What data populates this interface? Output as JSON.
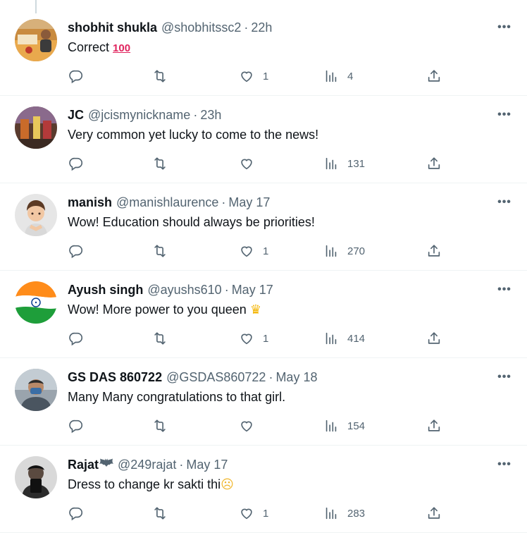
{
  "replies": [
    {
      "name": "shobhit shukla",
      "handle": "@shobhitssc2",
      "time": "22h",
      "text": "Correct",
      "emoji": "100",
      "likes": "1",
      "views": "4"
    },
    {
      "name": "JC",
      "handle": "@jcismynickname",
      "time": "23h",
      "text": "Very common yet lucky to come to the news!",
      "emoji": "",
      "likes": "",
      "views": "131"
    },
    {
      "name": "manish",
      "handle": "@manishlaurence",
      "time": "May 17",
      "text": "Wow! Education should always be priorities!",
      "emoji": "",
      "likes": "1",
      "views": "270"
    },
    {
      "name": "Ayush singh",
      "handle": "@ayushs610",
      "time": "May 17",
      "text": "Wow! More power to you queen",
      "emoji": "crown",
      "likes": "1",
      "views": "414"
    },
    {
      "name": "GS DAS 860722",
      "handle": "@GSDAS860722",
      "time": "May 18",
      "text": "Many Many congratulations to that girl.",
      "emoji": "",
      "likes": "",
      "views": "154"
    },
    {
      "name": "Rajat",
      "handle": "@249rajat",
      "time": "May 17",
      "text": "Dress to change kr sakti thi",
      "emoji": "crying-face",
      "likes": "1",
      "views": "283"
    }
  ],
  "separator": "·",
  "colors": {
    "text": "#0f1419",
    "secondary": "#536471",
    "border": "#eff3f4"
  },
  "icons": [
    "reply-icon",
    "retweet-icon",
    "like-icon",
    "views-icon",
    "share-icon",
    "more-icon"
  ]
}
